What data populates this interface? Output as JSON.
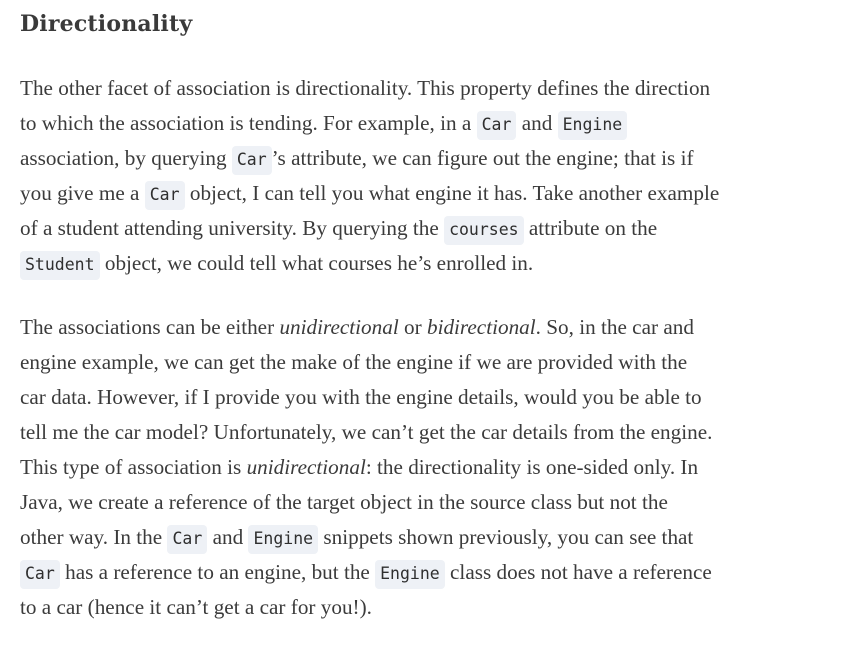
{
  "heading": "Directionality",
  "p1": {
    "l1_a": "The other facet of association is directionality. This property defines the direction",
    "l2_a": "to which the association is tending. For example, in a ",
    "l2_code1": "Car",
    "l2_b": " and ",
    "l2_code2": "Engine",
    "l3_a": "association, by querying ",
    "l3_code": "Car",
    "l3_b": "’s attribute, we can figure out the engine; that is if",
    "l4_a": "you give me a ",
    "l4_code": "Car",
    "l4_b": " object, I can tell you what engine it has. Take another example",
    "l5_a": "of a student attending university. By querying the ",
    "l5_code": "courses",
    "l5_b": " attribute on the",
    "l6_code": "Student",
    "l6_b": " object, we could tell what courses he’s enrolled in."
  },
  "p2": {
    "l1_a": "The associations can be either ",
    "l1_em1": "unidirectional",
    "l1_b": " or ",
    "l1_em2": "bidirectional",
    "l1_c": ". So, in the car and",
    "l2": "engine example, we can get the make of the engine if we are provided with the",
    "l3": "car data. However, if I provide you with the engine details, would you be able to",
    "l4": "tell me the car model? Unfortunately, we can’t get the car details from the engine.",
    "l5_a": "This type of association is ",
    "l5_em": "unidirectional",
    "l5_b": ": the directionality is one-sided only. In",
    "l6": "Java, we create a reference of the target object in the source class but not the",
    "l7_a": "other way. In the ",
    "l7_code1": "Car",
    "l7_b": " and ",
    "l7_code2": "Engine",
    "l7_c": " snippets shown previously, you can see that",
    "l8_code1": "Car",
    "l8_b": " has a reference to an engine, but the ",
    "l8_code2": "Engine",
    "l8_c": " class does not have a reference",
    "l9": "to a car (hence it can’t get a car for you!)."
  }
}
